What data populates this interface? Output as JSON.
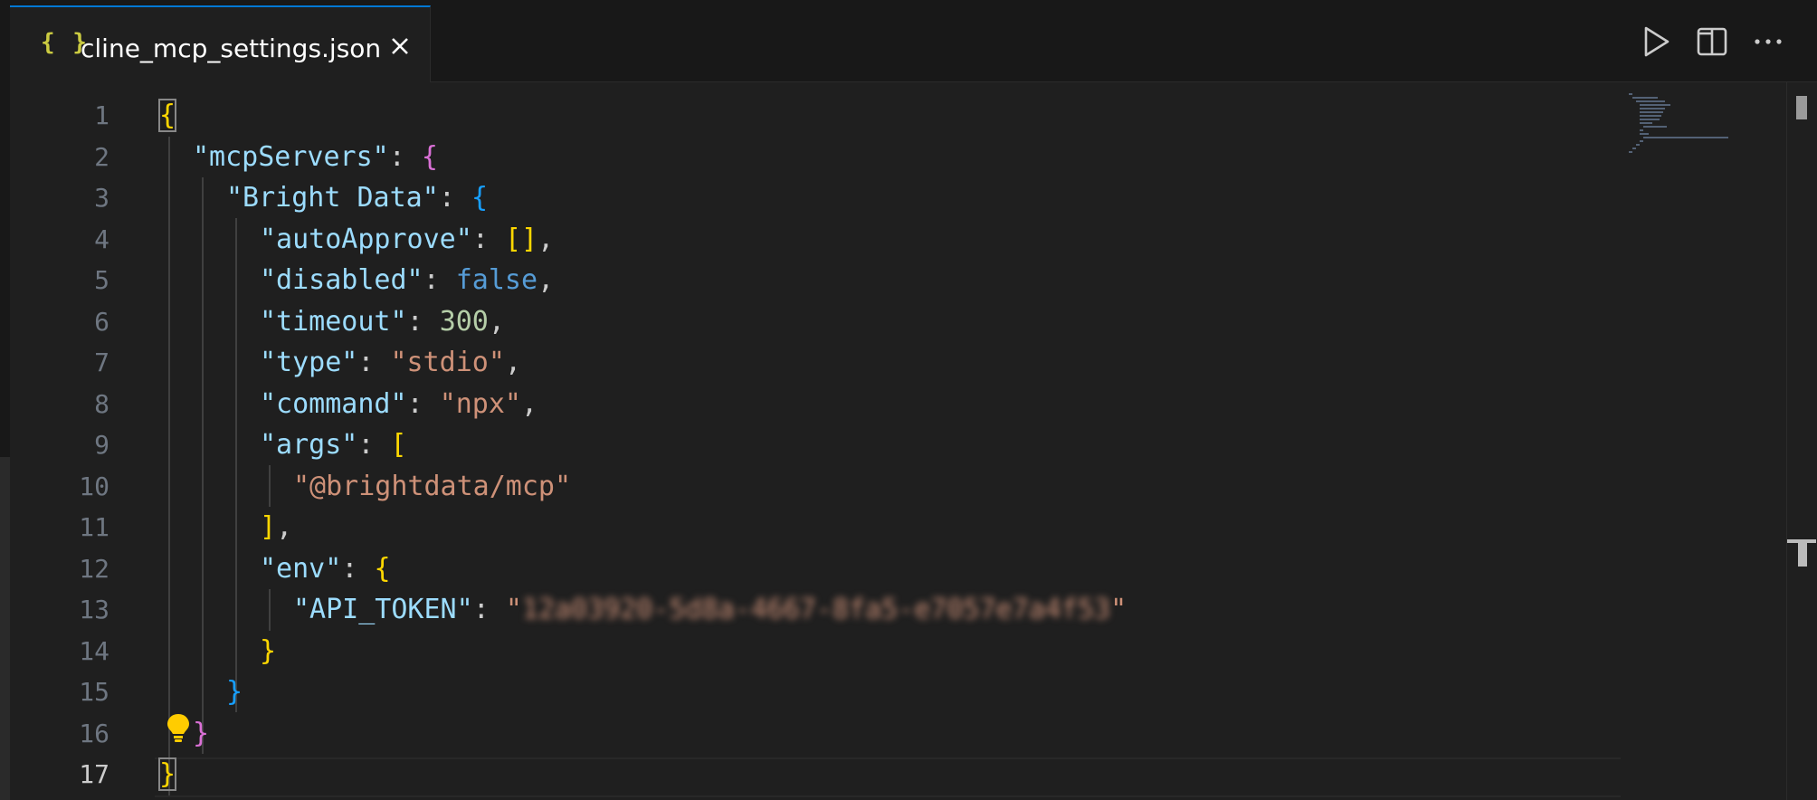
{
  "tab": {
    "icon_text": "{ }",
    "filename": "cline_mcp_settings.json"
  },
  "toolbar": {
    "run_icon": "play-icon",
    "split_icon": "split-editor-icon",
    "more_icon": "more-actions-icon"
  },
  "line_numbers": [
    "1",
    "2",
    "3",
    "4",
    "5",
    "6",
    "7",
    "8",
    "9",
    "10",
    "11",
    "12",
    "13",
    "14",
    "15",
    "16",
    "17"
  ],
  "active_line": "17",
  "code": {
    "l1": {
      "open": "{"
    },
    "l2": {
      "key": "\"mcpServers\"",
      "colon": ": ",
      "open": "{"
    },
    "l3": {
      "key": "\"Bright Data\"",
      "colon": ": ",
      "open": "{"
    },
    "l4": {
      "key": "\"autoApprove\"",
      "colon": ": ",
      "value": "[]",
      "comma": ","
    },
    "l5": {
      "key": "\"disabled\"",
      "colon": ": ",
      "value": "false",
      "comma": ","
    },
    "l6": {
      "key": "\"timeout\"",
      "colon": ": ",
      "value": "300",
      "comma": ","
    },
    "l7": {
      "key": "\"type\"",
      "colon": ": ",
      "value": "\"stdio\"",
      "comma": ","
    },
    "l8": {
      "key": "\"command\"",
      "colon": ": ",
      "value": "\"npx\"",
      "comma": ","
    },
    "l9": {
      "key": "\"args\"",
      "colon": ": ",
      "open": "["
    },
    "l10": {
      "value": "\"@brightdata/mcp\""
    },
    "l11": {
      "close": "]",
      "comma": ","
    },
    "l12": {
      "key": "\"env\"",
      "colon": ": ",
      "open": "{"
    },
    "l13": {
      "key": "\"API_TOKEN\"",
      "colon": ": ",
      "quote_open": "\"",
      "value_redacted": "12a03920-5d8a-4667-8fa5-e7057e7a4f53",
      "quote_close": "\""
    },
    "l14": {
      "close": "}"
    },
    "l15": {
      "close": "}"
    },
    "l16": {
      "close": "}"
    },
    "l17": {
      "close": "}"
    }
  },
  "colors": {
    "background": "#1f1f1f",
    "tab_accent": "#0078d4",
    "json_key": "#9cdcfe",
    "json_string": "#ce9178",
    "json_number": "#b5cea8",
    "json_boolean": "#569cd6",
    "bracket_level1": "#ffd700",
    "bracket_level2": "#da70d6",
    "bracket_level3": "#179fff",
    "lightbulb": "#ffcc00"
  },
  "lightbulb_icon": "lightbulb-icon"
}
